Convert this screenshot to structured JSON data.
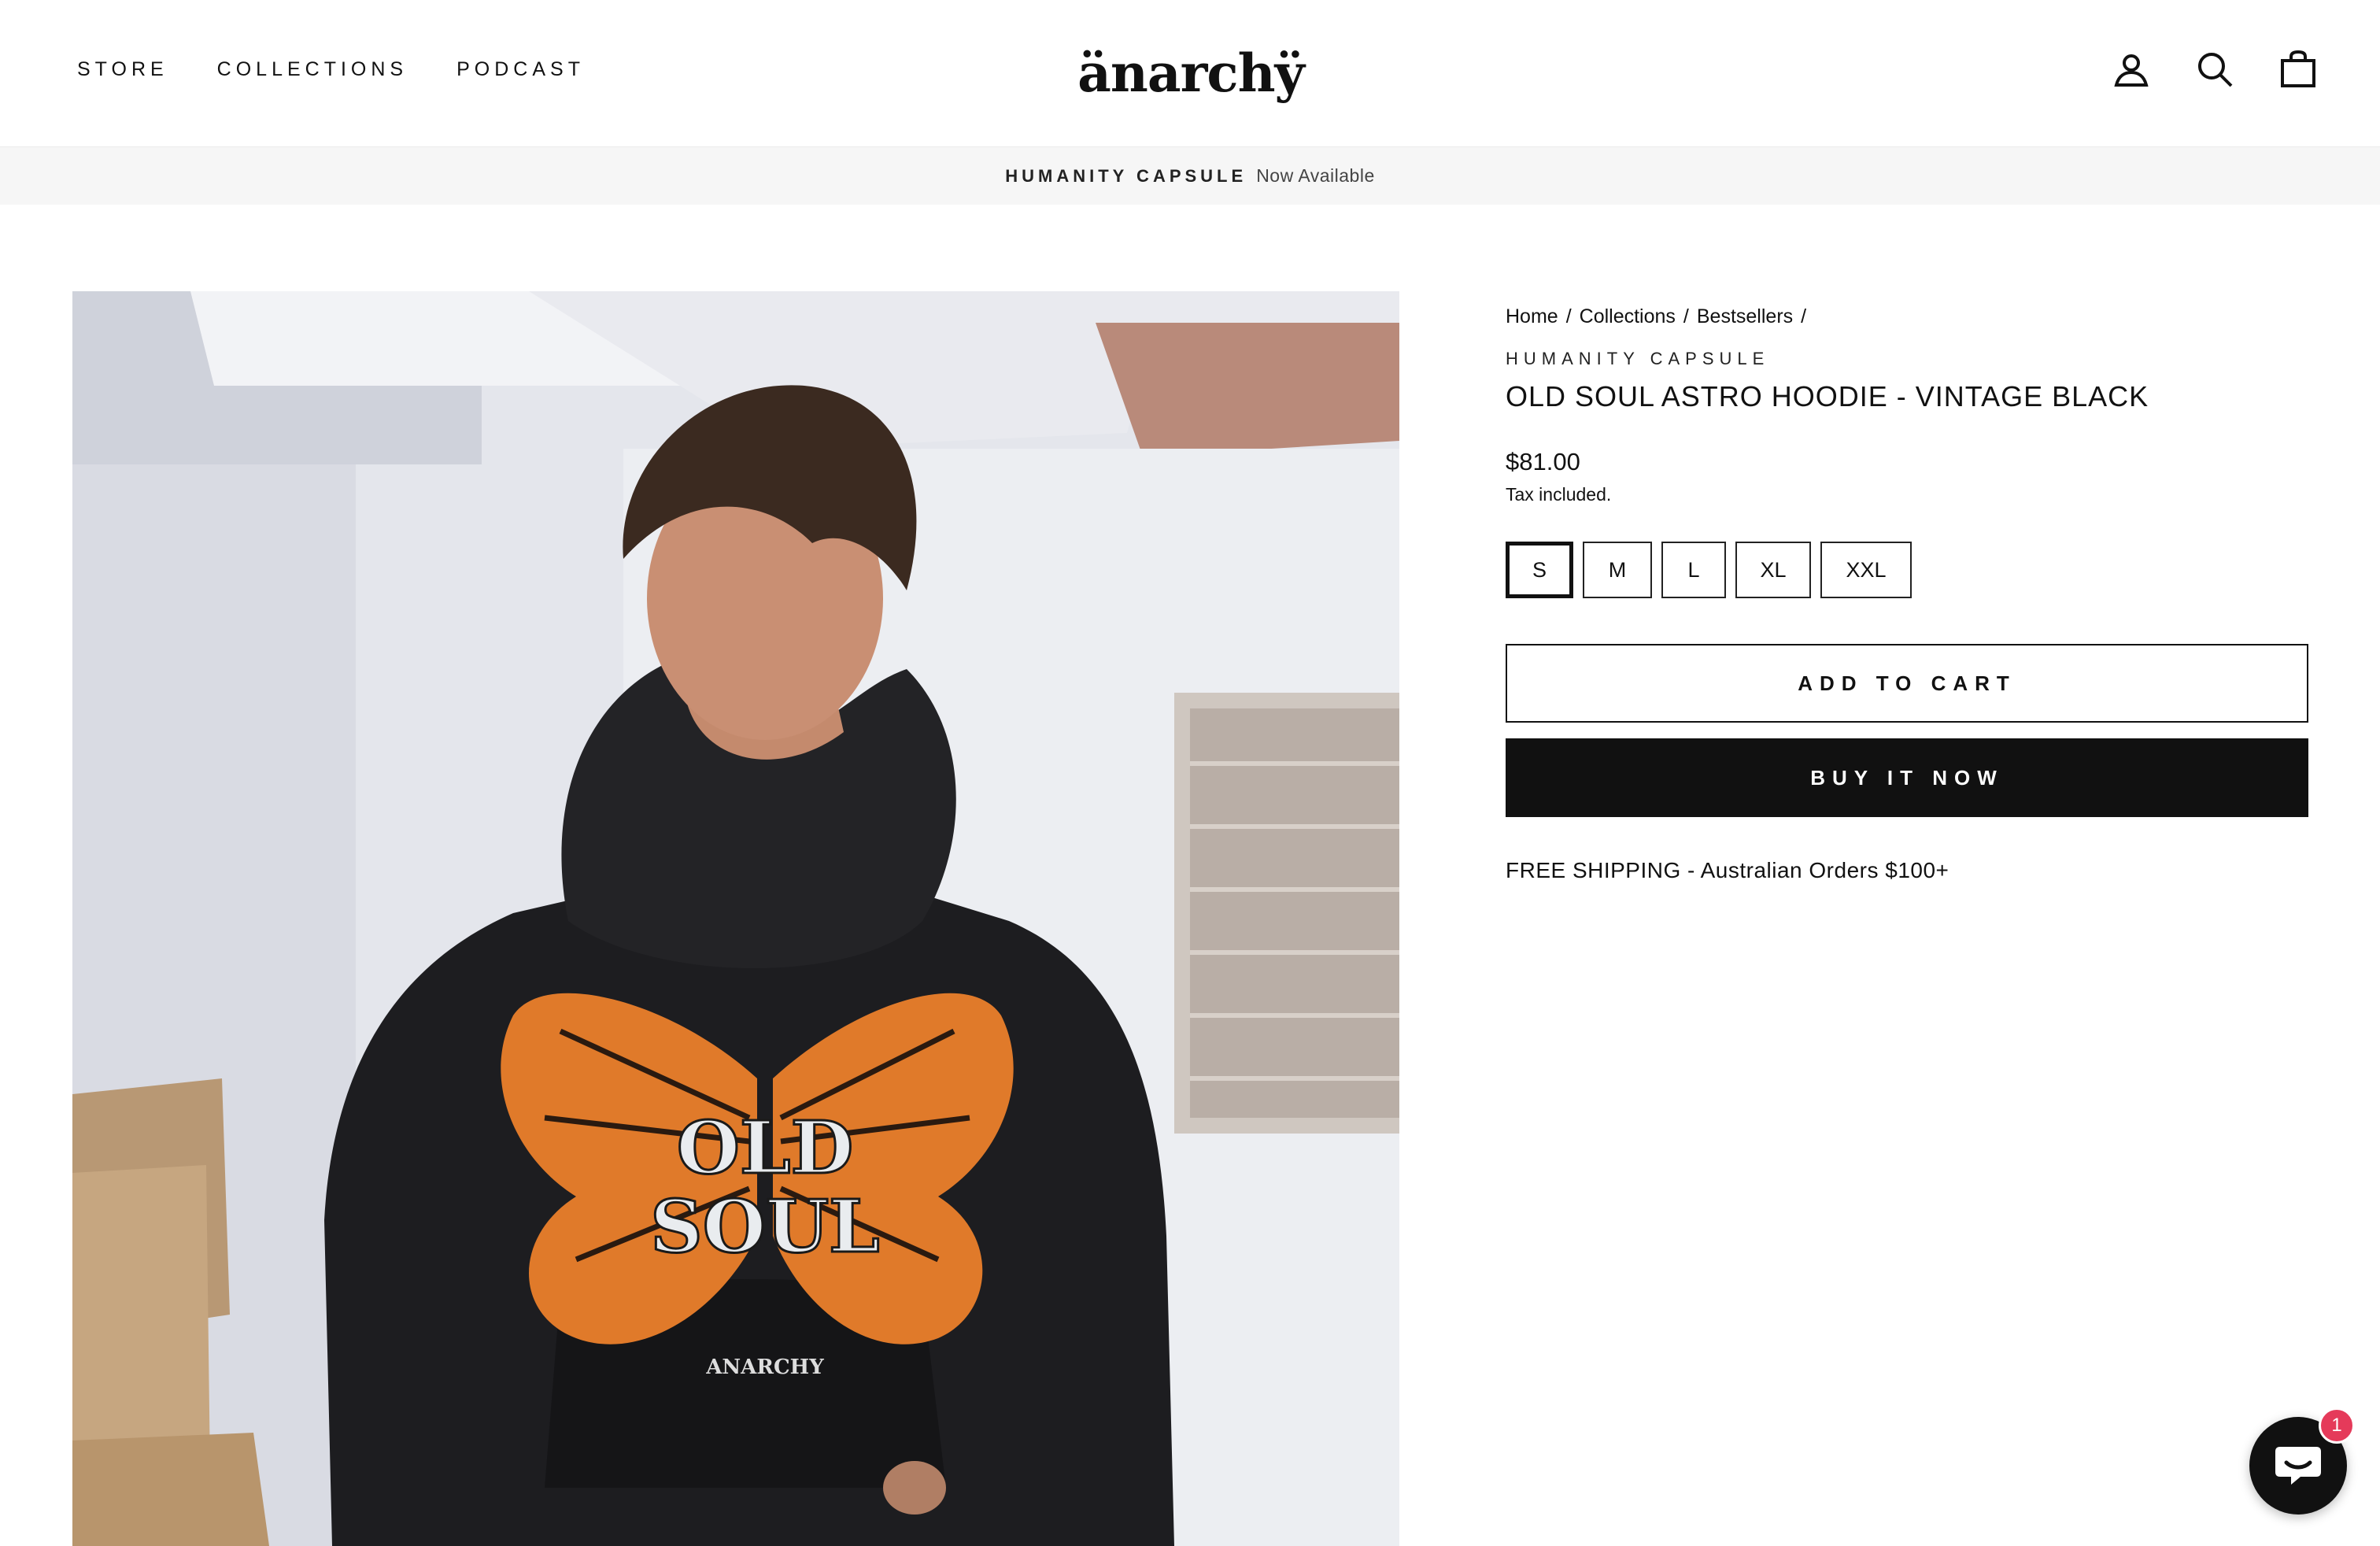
{
  "nav": {
    "items": [
      {
        "label": "STORE"
      },
      {
        "label": "COLLECTIONS"
      },
      {
        "label": "PODCAST"
      }
    ]
  },
  "brand": {
    "logo_text": "änarchÿ"
  },
  "header_icons": [
    "account-icon",
    "search-icon",
    "cart-bag-icon"
  ],
  "announcement": {
    "strong": "HUMANITY CAPSULE",
    "light": "Now Available"
  },
  "breadcrumb": {
    "items": [
      {
        "label": "Home"
      },
      {
        "label": "Collections"
      },
      {
        "label": "Bestsellers"
      }
    ],
    "separator": "/"
  },
  "product": {
    "vendor": "HUMANITY CAPSULE",
    "title": "OLD SOUL ASTRO HOODIE - VINTAGE BLACK",
    "price": "$81.00",
    "tax_note": "Tax included.",
    "sizes": [
      {
        "label": "S",
        "selected": true
      },
      {
        "label": "M",
        "selected": false
      },
      {
        "label": "L",
        "selected": false
      },
      {
        "label": "XL",
        "selected": false
      },
      {
        "label": "XXL",
        "selected": false
      }
    ],
    "add_to_cart_label": "ADD TO CART",
    "buy_now_label": "BUY IT NOW",
    "shipping_note": "FREE SHIPPING - Australian Orders $100+",
    "image_print_text": {
      "line1": "OLD",
      "line2": "SOUL",
      "brand": "ANARCHY"
    }
  },
  "chat": {
    "badge_count": "1"
  },
  "colors": {
    "text": "#111111",
    "announcement_bg": "#f6f6f6",
    "buy_button_bg": "#111111",
    "chat_badge": "#e53a5a"
  }
}
